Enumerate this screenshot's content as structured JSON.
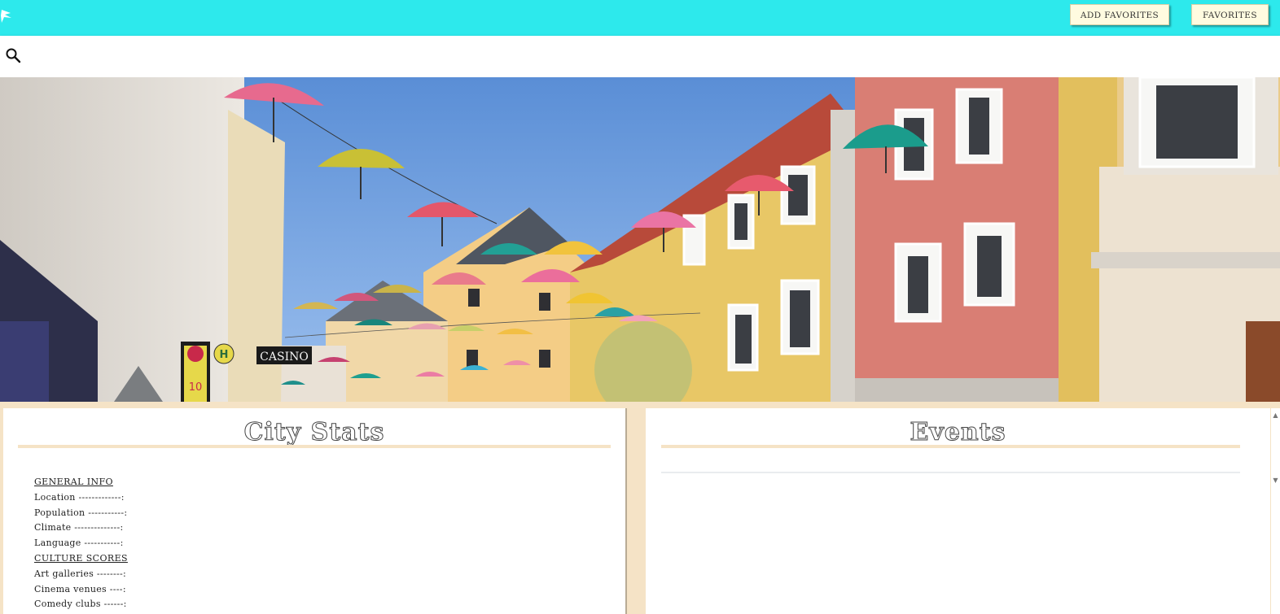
{
  "header": {
    "logo_icon": "bird-icon",
    "add_favorites_label": "ADD FAVORITES",
    "favorites_label": "FAVORITES",
    "accent_color": "#2de9ec"
  },
  "search": {
    "icon": "search-icon"
  },
  "hero": {
    "description_icon": "city-street-umbrellas-photo",
    "sign_text": "CASINO",
    "bus_stop_letter": "H",
    "bus_number": "10"
  },
  "city_stats": {
    "title": "City Stats",
    "items": [
      {
        "type": "section",
        "text": "GENERAL INFO"
      },
      {
        "type": "row",
        "text": "Location -------------:"
      },
      {
        "type": "row",
        "text": "Population -----------:"
      },
      {
        "type": "row",
        "text": "Climate --------------:"
      },
      {
        "type": "row",
        "text": "Language -----------:"
      },
      {
        "type": "section",
        "text": "CULTURE SCORES"
      },
      {
        "type": "row",
        "text": "Art galleries --------:"
      },
      {
        "type": "row",
        "text": "Cinema venues ----:"
      },
      {
        "type": "row",
        "text": "Comedy clubs ------:"
      }
    ]
  },
  "events": {
    "title": "Events"
  },
  "colors": {
    "panel_background": "#f5e3c6",
    "button_background": "#fffbe0"
  }
}
